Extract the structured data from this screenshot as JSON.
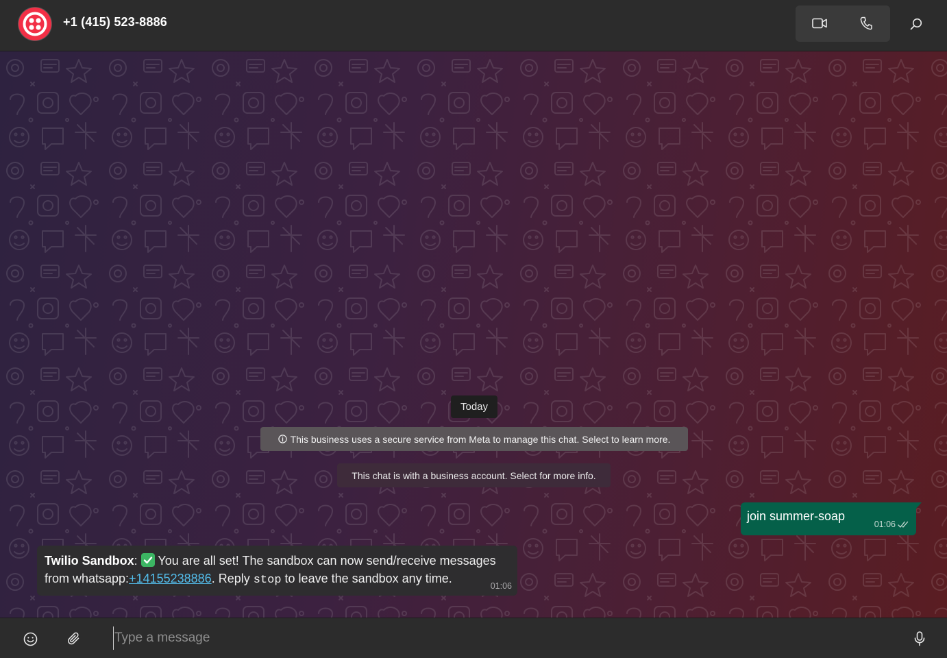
{
  "header": {
    "contact_name": "+1 (415) 523-8886",
    "avatar_icon": "twilio-logo-icon",
    "brand_color": "#f22f46",
    "actions": [
      "video-call-icon",
      "voice-call-icon",
      "search-icon"
    ]
  },
  "chat": {
    "date_divider": "Today",
    "security_notice": "This business uses a secure service from Meta to manage this chat. Select to learn more.",
    "business_notice": "This chat is with a business account. Select for more info.",
    "messages": [
      {
        "direction": "outgoing",
        "text": "join summer-soap",
        "time": "01:06",
        "status": "double-check-icon"
      },
      {
        "direction": "incoming",
        "sender": "Twilio Sandbox",
        "sender_suffix": ":",
        "emoji": "white-check-mark-icon",
        "text_1": " You are all set! The sandbox can now send/receive messages from whatsapp:",
        "link": "+14155238886",
        "text_2": ". Reply ",
        "code": "stop",
        "text_3": " to leave the sandbox any time.",
        "time": "01:06"
      }
    ]
  },
  "composer": {
    "placeholder": "Type a message",
    "value": ""
  },
  "colors": {
    "outgoing_bubble": "#056049",
    "incoming_bubble": "#2e2d2f",
    "link": "#53bdeb"
  }
}
